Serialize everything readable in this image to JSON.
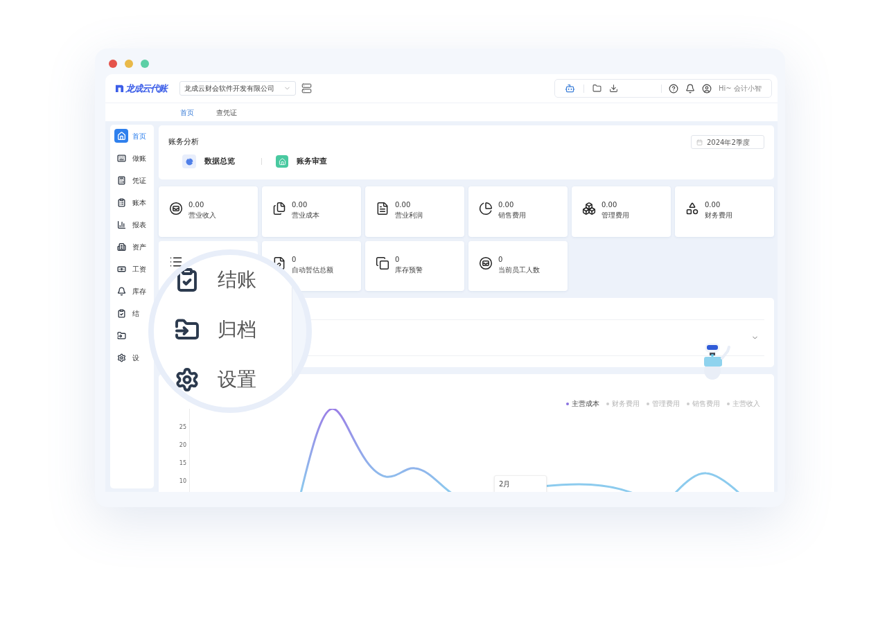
{
  "window": {
    "controls": [
      {
        "color": "#e5534b"
      },
      {
        "color": "#e9b949"
      },
      {
        "color": "#5ccfa6"
      }
    ]
  },
  "header": {
    "logo": "龙成云代账",
    "company_select": {
      "value": "龙成云财会软件开发有限公司"
    },
    "greeting": "Hi~ 会计小智"
  },
  "tabs": [
    {
      "label": "首页",
      "selected": true
    },
    {
      "label": "查凭证",
      "selected": false
    }
  ],
  "sidebar": {
    "items": [
      {
        "label": "首页",
        "selected": true
      },
      {
        "label": "做账",
        "selected": false
      },
      {
        "label": "凭证",
        "selected": false
      },
      {
        "label": "账本",
        "selected": false
      },
      {
        "label": "报表",
        "selected": false
      },
      {
        "label": "资产",
        "selected": false
      },
      {
        "label": "工资",
        "selected": false
      },
      {
        "label": "库存",
        "selected": false
      },
      {
        "label": "结",
        "selected": false
      },
      {
        "selected": false
      },
      {
        "label": "设",
        "selected": false
      }
    ]
  },
  "analysis": {
    "title": "账务分析",
    "period": "2024年2季度",
    "entries": [
      {
        "label": "数据总览"
      },
      {
        "label": "账务审查"
      }
    ]
  },
  "stats": [
    {
      "kind": "metric",
      "value": "0.00",
      "label": "营业收入"
    },
    {
      "kind": "metric",
      "value": "0.00",
      "label": "营业成本"
    },
    {
      "kind": "metric",
      "value": "0.00",
      "label": "营业利润"
    },
    {
      "kind": "metric",
      "value": "0.00",
      "label": "销售费用"
    },
    {
      "kind": "metric",
      "value": "0.00",
      "label": "管理费用"
    },
    {
      "kind": "metric",
      "value": "0.00",
      "label": "财务费用"
    },
    {
      "kind": "covered"
    },
    {
      "kind": "metric",
      "value": "0",
      "label": "自动暂估总额"
    },
    {
      "kind": "metric",
      "value": "0",
      "label": "库存预警"
    },
    {
      "kind": "metric",
      "value": "0",
      "label": "当前员工人数"
    }
  ],
  "chart": {
    "legend": [
      {
        "label": "主营成本",
        "on": true
      },
      {
        "label": "财务费用",
        "on": false
      },
      {
        "label": "管理费用",
        "on": false
      },
      {
        "label": "销售费用",
        "on": false
      },
      {
        "label": "主营收入",
        "on": false
      }
    ],
    "y_ticks": [
      "25",
      "20",
      "15",
      "10"
    ],
    "tooltip": "2月"
  },
  "magnifier": {
    "items": [
      "结账",
      "归档",
      "设置"
    ]
  }
}
